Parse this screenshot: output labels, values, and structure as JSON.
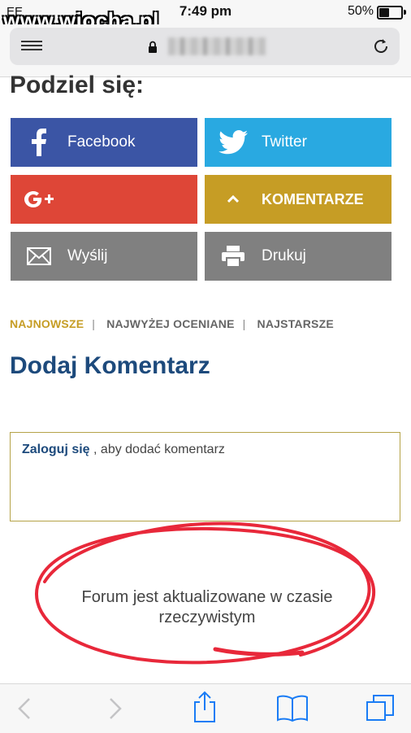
{
  "status_bar": {
    "carrier": "EE",
    "time": "7:49 pm",
    "battery": "50%"
  },
  "watermark": "www.wiocha.pl",
  "share": {
    "title": "Podziel się:",
    "buttons": {
      "facebook": "Facebook",
      "twitter": "Twitter",
      "comments": "KOMENTARZE",
      "email": "Wyślij",
      "print": "Drukuj"
    }
  },
  "sort": {
    "newest": "NAJNOWSZE",
    "top_rated": "NAJWYŻEJ OCENIANE",
    "oldest": "NAJSTARSZE"
  },
  "comment": {
    "title": "Dodaj Komentarz",
    "login_link": "Zaloguj się",
    "login_suffix": " , aby dodać komentarz"
  },
  "forum_note": "Forum jest aktualizowane w czasie rzeczywistym",
  "colors": {
    "facebook": "#3b55a5",
    "twitter": "#29a9e1",
    "google_plus": "#de4637",
    "gold": "#c69d25",
    "gray": "#808080",
    "title_blue": "#1d4a7c",
    "annotation_red": "#e8283a",
    "ios_blue": "#1a7cf5"
  },
  "icons": {
    "menu": "menu-icon",
    "lock": "lock-icon",
    "reload": "reload-icon",
    "facebook": "facebook-icon",
    "twitter": "twitter-icon",
    "google_plus": "google-plus-icon",
    "chevron_up": "chevron-up-icon",
    "mail": "mail-icon",
    "print": "printer-icon",
    "back": "back-icon",
    "forward": "forward-icon",
    "share": "share-icon",
    "bookmarks": "bookmarks-icon",
    "tabs": "tabs-icon"
  }
}
